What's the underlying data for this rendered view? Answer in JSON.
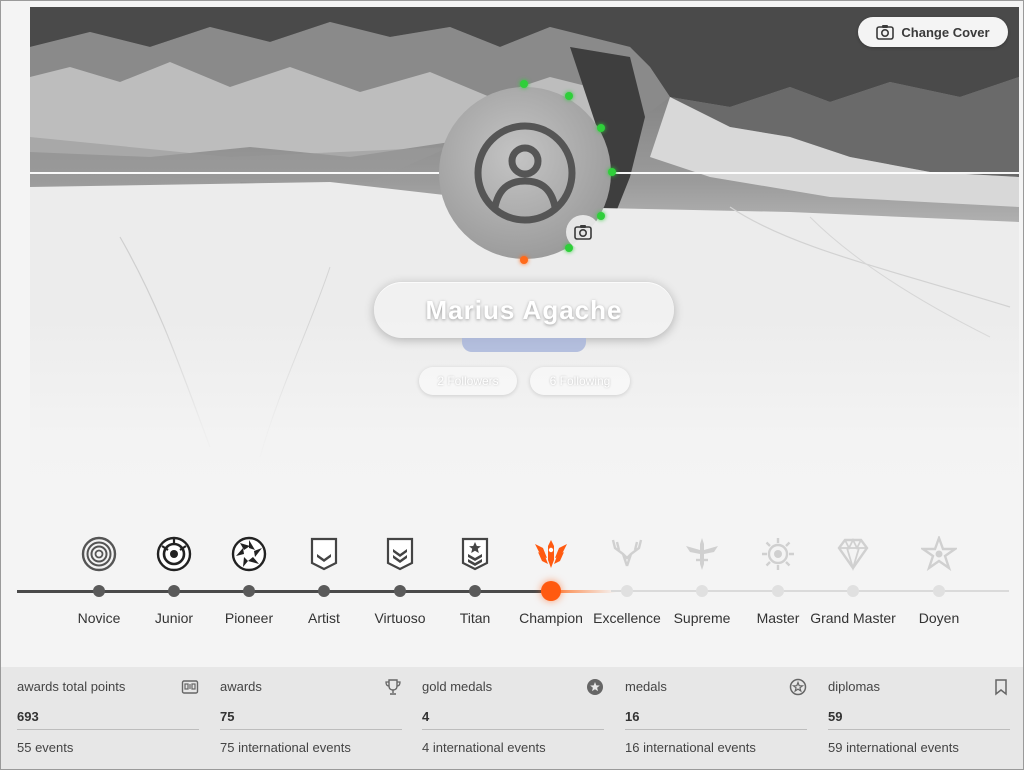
{
  "header": {
    "change_cover_label": "Change Cover"
  },
  "profile": {
    "name": "Marius Agache",
    "followers": "2 Followers",
    "following": "6 Following"
  },
  "colors": {
    "accent": "#ff5a10",
    "progress_dot_green": "#2fcf3a",
    "track_done": "#4a4a4a"
  },
  "levels": {
    "items": [
      {
        "label": "Novice",
        "icon": "concentric-target-icon",
        "state": "done"
      },
      {
        "label": "Junior",
        "icon": "camera-aperture-icon",
        "state": "done"
      },
      {
        "label": "Pioneer",
        "icon": "shutter-icon",
        "state": "done"
      },
      {
        "label": "Artist",
        "icon": "chevron-shield-icon",
        "state": "done"
      },
      {
        "label": "Virtuoso",
        "icon": "double-chevron-shield-icon",
        "state": "done"
      },
      {
        "label": "Titan",
        "icon": "star-shield-icon",
        "state": "done"
      },
      {
        "label": "Champion",
        "icon": "winged-emblem-icon",
        "state": "current"
      },
      {
        "label": "Excellence",
        "icon": "antlers-icon",
        "state": "future"
      },
      {
        "label": "Supreme",
        "icon": "winged-sword-icon",
        "state": "future"
      },
      {
        "label": "Master",
        "icon": "sun-gear-icon",
        "state": "future"
      },
      {
        "label": "Grand Master",
        "icon": "diamond-icon",
        "state": "future"
      },
      {
        "label": "Doyen",
        "icon": "flower-star-icon",
        "state": "future"
      }
    ]
  },
  "stats": {
    "items": [
      {
        "title": "awards total points",
        "value": "693",
        "events": "55 events",
        "icon": "points-counter-icon"
      },
      {
        "title": "awards",
        "value": "75",
        "events": "75 international events",
        "icon": "trophy-icon"
      },
      {
        "title": "gold medals",
        "value": "4",
        "events": "4 international events",
        "icon": "star-badge-icon"
      },
      {
        "title": "medals",
        "value": "16",
        "events": "16 international events",
        "icon": "medal-star-icon"
      },
      {
        "title": "diplomas",
        "value": "59",
        "events": "59 international events",
        "icon": "bookmark-icon"
      }
    ]
  }
}
